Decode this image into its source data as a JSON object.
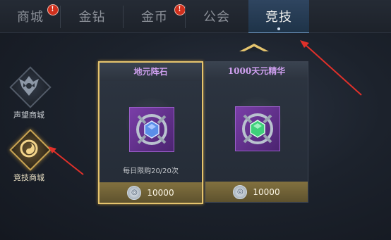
{
  "tabs": [
    {
      "label": "商城",
      "alert": true,
      "active": false
    },
    {
      "label": "金钻",
      "alert": false,
      "active": false
    },
    {
      "label": "金币",
      "alert": true,
      "active": false
    },
    {
      "label": "公会",
      "alert": false,
      "active": false
    },
    {
      "label": "竞技",
      "alert": false,
      "active": true
    }
  ],
  "alert_glyph": "!",
  "sidebar": {
    "items": [
      {
        "label": "声望商城",
        "icon": "demon-crest-icon",
        "active": false
      },
      {
        "label": "竞技商城",
        "icon": "arena-swirl-icon",
        "active": true
      }
    ]
  },
  "shop": {
    "items": [
      {
        "title": "地元阵石",
        "icon": "blue-gem-icon",
        "gem_color": "#5b8ee8",
        "limit_text": "每日限购20/20次",
        "price": "10000",
        "selected": true
      },
      {
        "title": "1000天元精华",
        "icon": "green-gem-icon",
        "gem_color": "#3fd07a",
        "limit_text": "",
        "price": "10000",
        "selected": false
      }
    ]
  },
  "colors": {
    "gold": "#e5c46e",
    "title_purple": "#d0a0f0",
    "alert_red": "#d0301d",
    "annotation_red": "#e0302a"
  }
}
